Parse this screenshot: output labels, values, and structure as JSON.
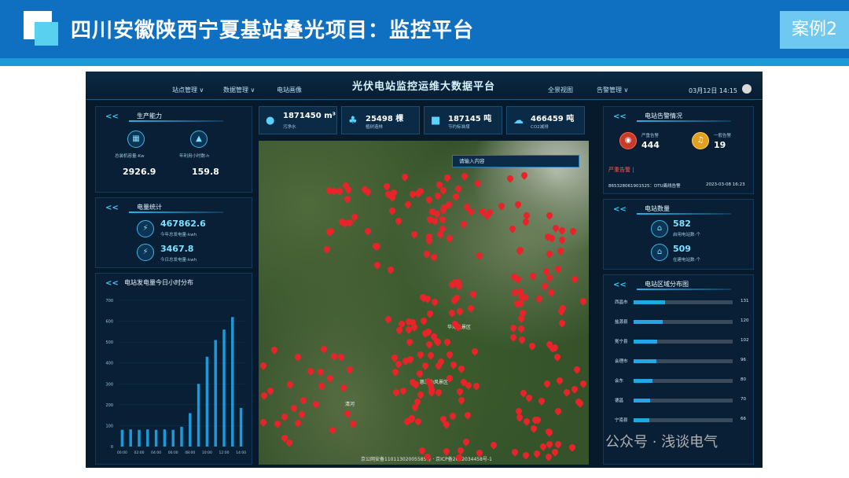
{
  "slide": {
    "title": "四川安徽陕西宁夏基站叠光项目：监控平台",
    "case_label": "案例2",
    "wechat_watermark": "公众号 · 浅谈电气"
  },
  "dashboard": {
    "title": "光伏电站监控运维大数据平台",
    "nav_left": [
      "站点管理 ∨",
      "数据管理 ∨",
      "电站画像"
    ],
    "nav_right": [
      "全景视图",
      "告警管理 ∨"
    ],
    "datetime": "03月12日 14:15"
  },
  "production": {
    "title": "生产能力",
    "items": [
      {
        "label": "总装机容量-Kw",
        "value": "2926.9",
        "icon": "panel-icon"
      },
      {
        "label": "年利用小时数-h",
        "value": "159.8",
        "icon": "mountain-icon"
      }
    ]
  },
  "energy": {
    "title": "电量统计",
    "items": [
      {
        "value": "467862.6",
        "label": "今年总发电量-kwh"
      },
      {
        "value": "3467.8",
        "label": "今日总发电量-kwh"
      }
    ]
  },
  "hourly": {
    "title": "电站发电量今日小时分布"
  },
  "stats": [
    {
      "value": "1871450 m³",
      "label": "污净水",
      "icon": "water-drop-icon"
    },
    {
      "value": "25498 棵",
      "label": "植树造林",
      "icon": "tree-icon"
    },
    {
      "value": "187145 吨",
      "label": "节约标准煤",
      "icon": "coal-icon"
    },
    {
      "value": "466459 吨",
      "label": "CO2减排",
      "icon": "co2-icon"
    }
  ],
  "map": {
    "search_placeholder": "请输入内容",
    "labels": [
      "华海风景区",
      "清河",
      "慈恩山风景区"
    ],
    "footer": "京公网安备11011302005585号 · 京ICP备2022034458号-1"
  },
  "alarms": {
    "title": "电站告警情况",
    "severe_label": "严重告警",
    "severe_count": "444",
    "general_label": "一般告警",
    "general_count": "19",
    "severe_header": "严重告警 |",
    "row_text": "865328061901525：DTU离线告警",
    "row_time": "2023-03-08 16:23"
  },
  "station_count": {
    "title": "电站数量",
    "items": [
      {
        "value": "582",
        "label": "启用电站数-个"
      },
      {
        "value": "509",
        "label": "在建电站数-个"
      }
    ]
  },
  "region": {
    "title": "电站区域分布图",
    "rows": [
      {
        "name": "西昌市",
        "value": "131",
        "frac": 0.32
      },
      {
        "name": "盐源县",
        "value": "120",
        "frac": 0.29
      },
      {
        "name": "冕宁县",
        "value": "102",
        "frac": 0.24
      },
      {
        "name": "会理市",
        "value": "96",
        "frac": 0.23
      },
      {
        "name": "会东",
        "value": "80",
        "frac": 0.19
      },
      {
        "name": "德昌",
        "value": "70",
        "frac": 0.17
      },
      {
        "name": "宁南县",
        "value": "66",
        "frac": 0.16
      }
    ]
  },
  "chart_data": {
    "type": "bar",
    "title": "电站发电量今日小时分布",
    "categories": [
      "00:00",
      "01:00",
      "02:00",
      "03:00",
      "04:00",
      "05:00",
      "06:00",
      "07:00",
      "08:00",
      "09:00",
      "10:00",
      "11:00",
      "12:00",
      "13:00",
      "14:00"
    ],
    "values": [
      80,
      82,
      80,
      82,
      80,
      82,
      80,
      95,
      160,
      300,
      430,
      510,
      560,
      620,
      185
    ],
    "yticks": [
      "0",
      "100",
      "200",
      "300",
      "400",
      "500",
      "600",
      "700"
    ],
    "xticks": [
      "00:00",
      "02:00",
      "04:00",
      "06:00",
      "08:00",
      "10:00",
      "12:00",
      "14:00"
    ],
    "ylim": [
      0,
      700
    ],
    "bar_color": "#1c9ad8"
  }
}
